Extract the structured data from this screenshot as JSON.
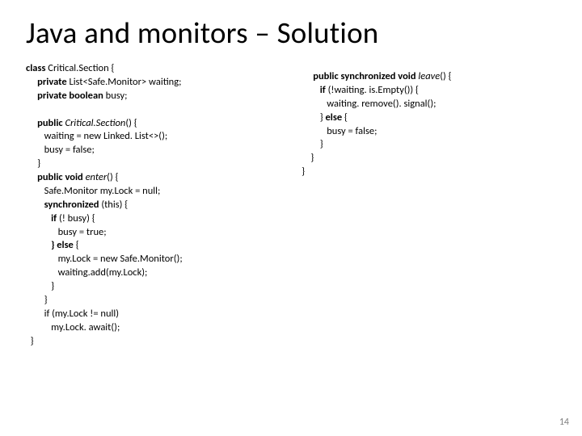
{
  "title": "Java and monitors – Solution",
  "left": {
    "l01a": "class ",
    "l01b": "Critical.Section {",
    "l02a": "     private ",
    "l02b": "List<Safe.Monitor> waiting;",
    "l03a": "     private boolean ",
    "l03b": "busy;",
    "l04a": "     public ",
    "l04b": "Critical.Section",
    "l04c": "() {",
    "l05": "        waiting = new Linked. List<>();",
    "l06": "        busy = false;",
    "l07": "     }",
    "l08a": "     public void ",
    "l08b": "enter",
    "l08c": "() {",
    "l09": "        Safe.Monitor my.Lock = null;",
    "l10a": "        synchronized ",
    "l10b": "(this) {",
    "l11a": "           if ",
    "l11b": "(! busy) {",
    "l12": "              busy = true;",
    "l13a": "           } else ",
    "l13b": "{",
    "l14": "              my.Lock = new Safe.Monitor();",
    "l15": "              waiting.add(my.Lock);",
    "l16": "           }",
    "l17": "        }",
    "l18": "        if (my.Lock != null)",
    "l19": "           my.Lock. await();",
    "l20": "  }"
  },
  "right": {
    "l01a": "     public synchronized void ",
    "l01b": "leave",
    "l01c": "() {",
    "l02a": "        if ",
    "l02b": "(!waiting. is.Empty()) {",
    "l03": "           waiting. remove(). signal();",
    "l04a": "        } ",
    "l04b": "else ",
    "l04c": "{",
    "l05": "           busy = false;",
    "l06": "        }",
    "l07": "    }",
    "l08": "}"
  },
  "pagenum": "14"
}
